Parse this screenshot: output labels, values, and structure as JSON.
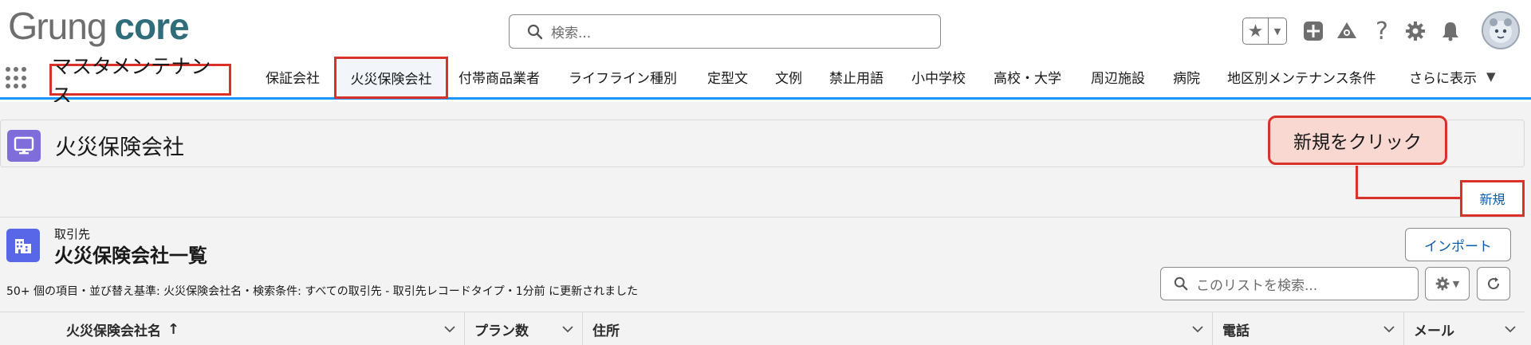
{
  "header": {
    "logo": {
      "g": "G",
      "rest": "rung",
      "core": "core"
    },
    "search_placeholder": "検索..."
  },
  "nav": {
    "app_name": "マスタメンテナンス",
    "tabs": [
      {
        "label": "保証会社"
      },
      {
        "label": "火災保険会社",
        "active": true
      },
      {
        "label": "付帯商品業者"
      },
      {
        "label": "ライフライン種別"
      },
      {
        "label": "定型文"
      },
      {
        "label": "文例"
      },
      {
        "label": "禁止用語"
      },
      {
        "label": "小中学校"
      },
      {
        "label": "高校・大学"
      },
      {
        "label": "周辺施設"
      },
      {
        "label": "病院"
      },
      {
        "label": "地区別メンテナンス条件"
      }
    ],
    "more_label": "さらに表示"
  },
  "object_header": {
    "title": "火災保険会社"
  },
  "annotation": {
    "callout_text": "新規をクリック"
  },
  "actions": {
    "new_label": "新規"
  },
  "list": {
    "object_label": "取引先",
    "title": "火災保険会社一覧",
    "import_label": "インポート",
    "search_placeholder": "このリストを検索...",
    "meta": "50+ 個の項目・並び替え基準: 火災保険会社名・検索条件: すべての取引先 - 取引先レコードタイプ・1分前 に更新されました",
    "columns": [
      {
        "label": "火災保険会社名",
        "sorted": "asc"
      },
      {
        "label": "プラン数"
      },
      {
        "label": "住所"
      },
      {
        "label": "電話"
      },
      {
        "label": "メール"
      }
    ]
  },
  "colors": {
    "brand_teal": "#2f6d7a",
    "accent_blue": "#1b96ff",
    "annotation_red": "#d9322b",
    "link_blue": "#0b5cab",
    "object_icon_purple": "#7f6ed9",
    "list_icon_blue": "#5867e8"
  }
}
